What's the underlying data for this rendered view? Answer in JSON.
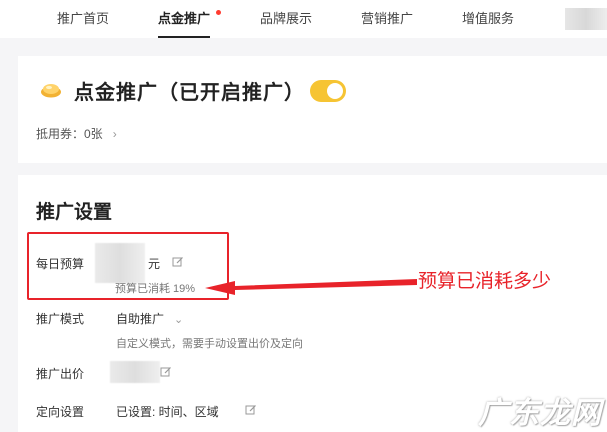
{
  "nav": {
    "tabs": [
      {
        "label": "推广首页"
      },
      {
        "label": "点金推广"
      },
      {
        "label": "品牌展示"
      },
      {
        "label": "营销推广"
      },
      {
        "label": "增值服务"
      }
    ],
    "active": "点金推广"
  },
  "promo_card": {
    "title": "点金推广（已开启推广）",
    "toggle_on": true,
    "coupon_label": "抵用券：0张",
    "coupon_chevron": "›"
  },
  "settings": {
    "title": "推广设置",
    "daily_budget": {
      "label": "每日预算",
      "unit": "元",
      "consumed_text": "预算已消耗 19%",
      "consumed_percent": 19
    },
    "mode": {
      "label": "推广模式",
      "value": "自助推广",
      "hint": "自定义模式，需要手动设置出价及定向"
    },
    "bid": {
      "label": "推广出价"
    },
    "targeting": {
      "label": "定向设置",
      "value": "已设置: 时间、区域"
    }
  },
  "annotation": {
    "text": "预算已消耗多少",
    "color": "#e8232a"
  },
  "watermark": "广东龙网",
  "colors": {
    "toggle": "#f6c433",
    "highlight": "#e8232a",
    "notify_dot": "#ff3b30"
  }
}
